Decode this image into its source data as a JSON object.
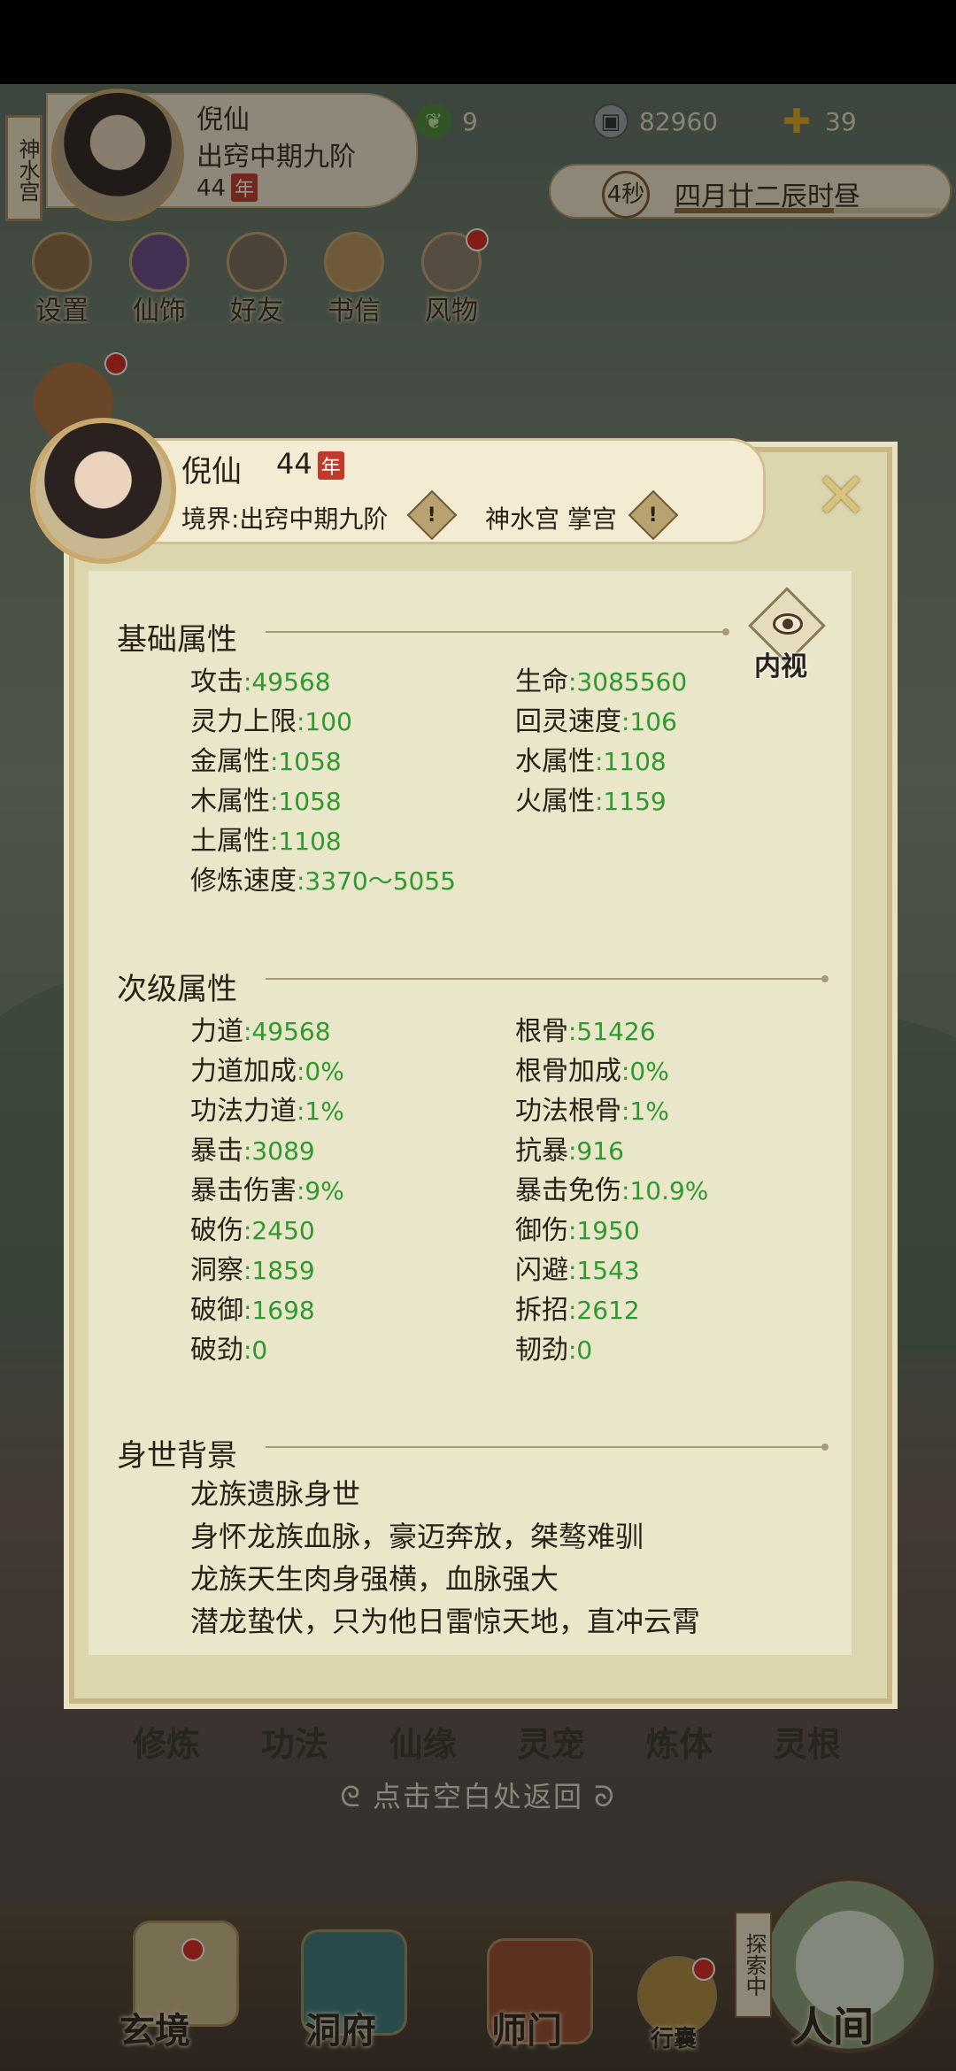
{
  "header": {
    "sect_tag": "神水宫",
    "player_name": "倪仙",
    "realm": "出窍中期九阶",
    "age": "44",
    "age_unit": "年",
    "resources": [
      {
        "icon": "jade-leaf-icon",
        "value": "9"
      },
      {
        "icon": "coin-icon",
        "value": "82960"
      },
      {
        "icon": "gold-ingot-icon",
        "value": "39"
      }
    ],
    "timer_seconds": "4秒",
    "game_date": "四月廿二辰时昼"
  },
  "top_menu": [
    {
      "label": "设置",
      "icon": "settings-icon"
    },
    {
      "label": "仙饰",
      "icon": "costume-icon"
    },
    {
      "label": "好友",
      "icon": "friends-icon"
    },
    {
      "label": "书信",
      "icon": "letter-icon"
    },
    {
      "label": "风物",
      "icon": "scenery-icon"
    }
  ],
  "panel": {
    "name": "倪仙",
    "age": "44",
    "age_unit": "年",
    "realm_label": "境界:出窍中期九阶",
    "sect_role": "神水宫 掌宫",
    "inner_view_label": "内视",
    "close_glyph": "✕",
    "basic_title": "基础属性",
    "basic_stats": [
      {
        "label": "攻击",
        "value": ":49568"
      },
      {
        "label": "生命",
        "value": ":3085560"
      },
      {
        "label": "灵力上限",
        "value": ":100"
      },
      {
        "label": "回灵速度",
        "value": ":106"
      },
      {
        "label": "金属性",
        "value": ":1058"
      },
      {
        "label": "水属性",
        "value": ":1108"
      },
      {
        "label": "木属性",
        "value": ":1058"
      },
      {
        "label": "火属性",
        "value": ":1159"
      },
      {
        "label": "土属性",
        "value": ":1108"
      },
      {
        "label": "修炼速度",
        "value": ":3370～5055"
      }
    ],
    "secondary_title": "次级属性",
    "secondary_stats": [
      {
        "label": "力道",
        "value": ":49568"
      },
      {
        "label": "根骨",
        "value": ":51426"
      },
      {
        "label": "力道加成",
        "value": ":0%"
      },
      {
        "label": "根骨加成",
        "value": ":0%"
      },
      {
        "label": "功法力道",
        "value": ":1%"
      },
      {
        "label": "功法根骨",
        "value": ":1%"
      },
      {
        "label": "暴击",
        "value": ":3089"
      },
      {
        "label": "抗暴",
        "value": ":916"
      },
      {
        "label": "暴击伤害",
        "value": ":9%"
      },
      {
        "label": "暴击免伤",
        "value": ":10.9%"
      },
      {
        "label": "破伤",
        "value": ":2450"
      },
      {
        "label": "御伤",
        "value": ":1950"
      },
      {
        "label": "洞察",
        "value": ":1859"
      },
      {
        "label": "闪避",
        "value": ":1543"
      },
      {
        "label": "破御",
        "value": ":1698"
      },
      {
        "label": "拆招",
        "value": ":2612"
      },
      {
        "label": "破劲",
        "value": ":0"
      },
      {
        "label": "韧劲",
        "value": ":0"
      }
    ],
    "background_title": "身世背景",
    "background_lines": [
      "龙族遗脉身世",
      "身怀龙族血脉，豪迈奔放，桀骜难驯",
      "龙族天生肉身强横，血脉强大",
      "潜龙蛰伏，只为他日雷惊天地，直冲云霄"
    ]
  },
  "bottom_tabs": [
    "修炼",
    "功法",
    "仙缘",
    "灵宠",
    "炼体",
    "灵根"
  ],
  "back_hint": "点击空白处返回",
  "bottom_nav": [
    {
      "label": "玄境",
      "icon": "scroll-icon"
    },
    {
      "label": "洞府",
      "icon": "pavilion-icon"
    },
    {
      "label": "师门",
      "icon": "banner-icon"
    },
    {
      "label": "行囊",
      "icon": "bag-icon"
    },
    {
      "label": "人间",
      "icon": "world-icon"
    }
  ],
  "explore_label": "探索中",
  "colors": {
    "stat_value": "#2e9a2e",
    "red_badge": "#d9261c",
    "panel_bg": "#eae6c9"
  }
}
